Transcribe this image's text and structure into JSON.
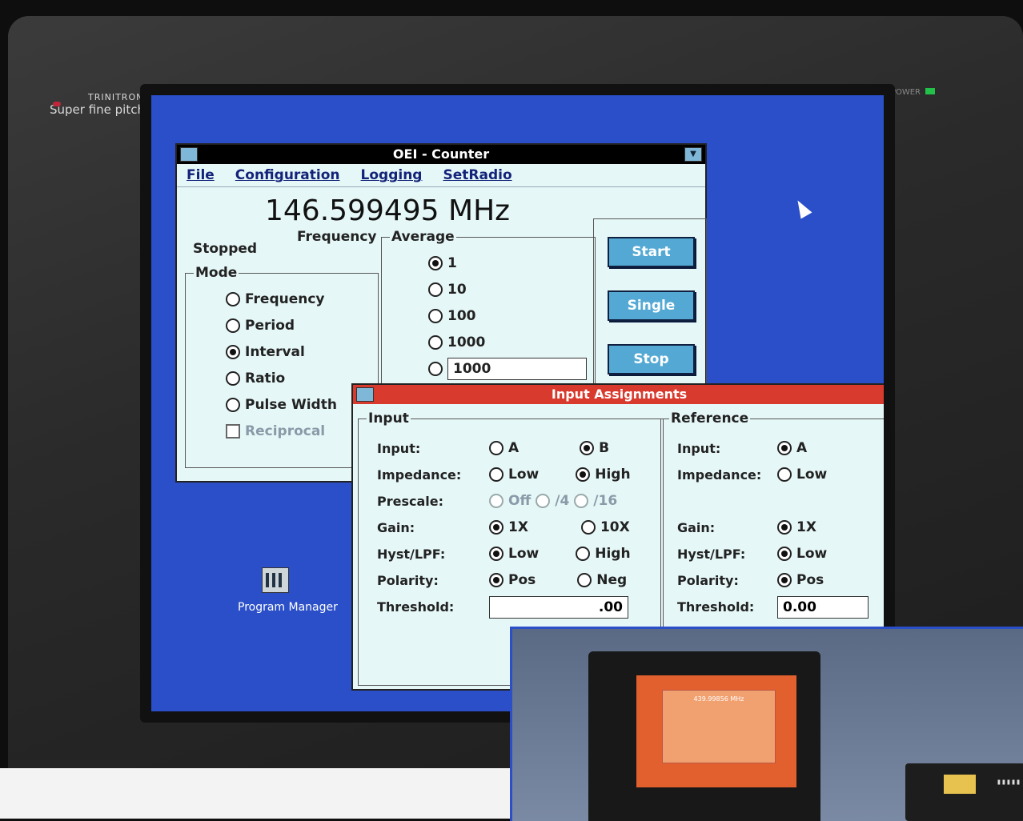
{
  "monitor": {
    "brand_line1": "TRINITRON",
    "brand_line2": "Super fine pitch",
    "power_label": "POWER"
  },
  "counter_window": {
    "title": "OEI - Counter",
    "menu": [
      "File",
      "Configuration",
      "Logging",
      "SetRadio"
    ],
    "frequency_value": "146.599495 MHz",
    "frequency_label": "Frequency",
    "status": "Stopped",
    "mode": {
      "legend": "Mode",
      "options": [
        "Frequency",
        "Period",
        "Interval",
        "Ratio",
        "Pulse Width"
      ],
      "selected": "Interval",
      "reciprocal_label": "Reciprocal"
    },
    "average": {
      "legend": "Average",
      "options": [
        "1",
        "10",
        "100",
        "1000"
      ],
      "selected": "1",
      "custom_value": "1000"
    },
    "buttons": {
      "start": "Start",
      "single": "Single",
      "stop": "Stop"
    }
  },
  "input_window": {
    "title": "Input Assignments",
    "input_group": {
      "legend": "Input",
      "labels": [
        "Input:",
        "Impedance:",
        "Prescale:",
        "Gain:",
        "Hyst/LPF:",
        "Polarity:",
        "Threshold:"
      ],
      "input_options": [
        "A",
        "B"
      ],
      "input_selected": "B",
      "impedance_options": [
        "Low",
        "High"
      ],
      "impedance_selected": "High",
      "prescale_options": [
        "Off",
        "/4",
        "/16"
      ],
      "gain_options": [
        "1X",
        "10X"
      ],
      "gain_selected": "1X",
      "hyst_options": [
        "Low",
        "High"
      ],
      "hyst_selected": "Low",
      "polarity_options": [
        "Pos",
        "Neg"
      ],
      "polarity_selected": "Pos",
      "threshold_value": ".00"
    },
    "reference_group": {
      "legend": "Reference",
      "labels": [
        "Input:",
        "Impedance:",
        "Gain:",
        "Hyst/LPF:",
        "Polarity:",
        "Threshold:"
      ],
      "input_option": "A",
      "impedance_option": "Low",
      "gain_option": "1X",
      "hyst_option": "Low",
      "polarity_option": "Pos",
      "threshold_value": "0.00"
    }
  },
  "desktop": {
    "program_manager_label": "Program Manager"
  },
  "inset_photo": {
    "mini_frequency": "439.99856 MHz"
  }
}
